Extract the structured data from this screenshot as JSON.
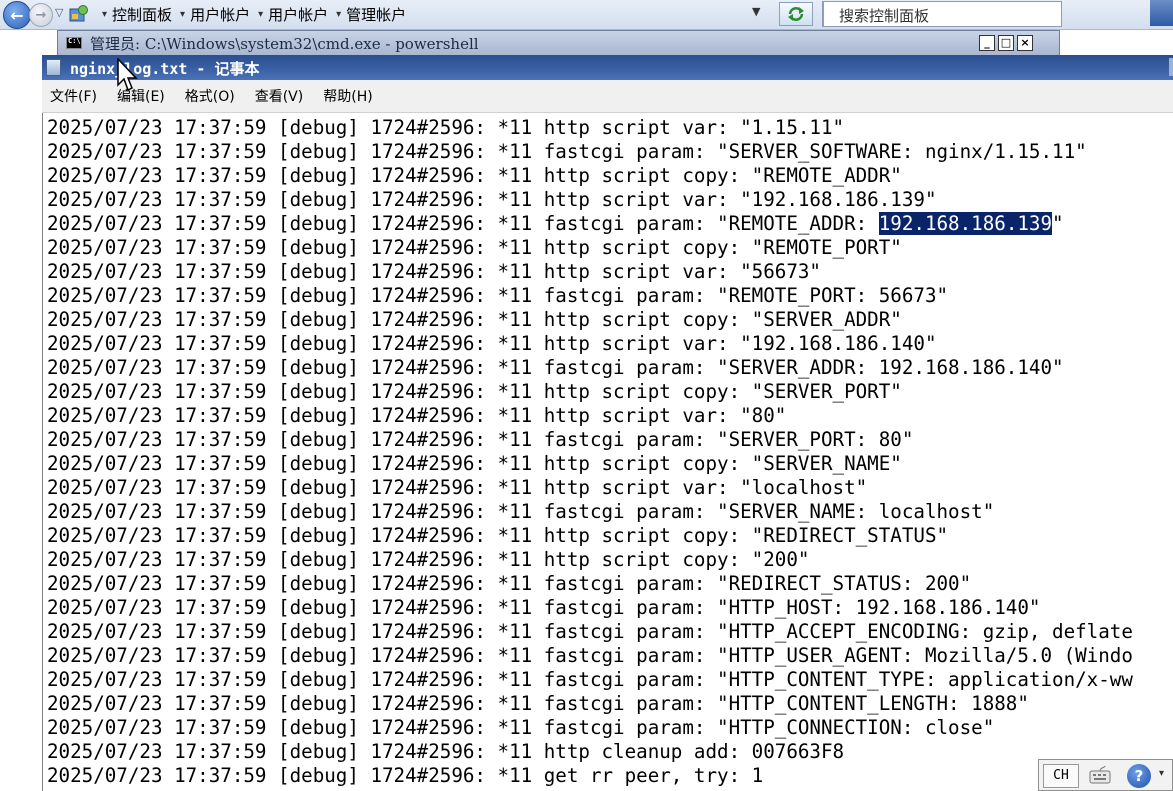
{
  "explorer": {
    "breadcrumbs": [
      "控制面板",
      "用户帐户",
      "用户帐户",
      "管理帐户"
    ],
    "search_placeholder": "搜索控制面板"
  },
  "cmd_window": {
    "title": "管理员: C:\\Windows\\system32\\cmd.exe - powershell"
  },
  "notepad": {
    "title": "nginx_log.txt - 记事本",
    "menu": [
      "文件(F)",
      "编辑(E)",
      "格式(O)",
      "查看(V)",
      "帮助(H)"
    ],
    "line_prefix": "2025/07/23 17:37:59 [debug] 1724#2596: *11 ",
    "lines": [
      "http script var: \"1.15.11\"",
      "fastcgi param: \"SERVER_SOFTWARE: nginx/1.15.11\"",
      "http script copy: \"REMOTE_ADDR\"",
      "http script var: \"192.168.186.139\"",
      "fastcgi param: \"REMOTE_ADDR: 192.168.186.139\"",
      "http script copy: \"REMOTE_PORT\"",
      "http script var: \"56673\"",
      "fastcgi param: \"REMOTE_PORT: 56673\"",
      "http script copy: \"SERVER_ADDR\"",
      "http script var: \"192.168.186.140\"",
      "fastcgi param: \"SERVER_ADDR: 192.168.186.140\"",
      "http script copy: \"SERVER_PORT\"",
      "http script var: \"80\"",
      "fastcgi param: \"SERVER_PORT: 80\"",
      "http script copy: \"SERVER_NAME\"",
      "http script var: \"localhost\"",
      "fastcgi param: \"SERVER_NAME: localhost\"",
      "http script copy: \"REDIRECT_STATUS\"",
      "http script copy: \"200\"",
      "fastcgi param: \"REDIRECT_STATUS: 200\"",
      "fastcgi param: \"HTTP_HOST: 192.168.186.140\"",
      "fastcgi param: \"HTTP_ACCEPT_ENCODING: gzip, deflate",
      "fastcgi param: \"HTTP_USER_AGENT: Mozilla/5.0 (Windo",
      "fastcgi param: \"HTTP_CONTENT_TYPE: application/x-ww",
      "fastcgi param: \"HTTP_CONTENT_LENGTH: 1888\"",
      "fastcgi param: \"HTTP_CONNECTION: close\"",
      "http cleanup add: 007663F8",
      "get rr peer, try: 1"
    ],
    "selection": {
      "line": 5,
      "before": "fastcgi param: \"REMOTE_ADDR: ",
      "text": "192.168.186.139",
      "after": "\""
    }
  },
  "language_bar": {
    "lang": "CH",
    "icons": [
      "keyboard-icon",
      "help-icon"
    ]
  }
}
